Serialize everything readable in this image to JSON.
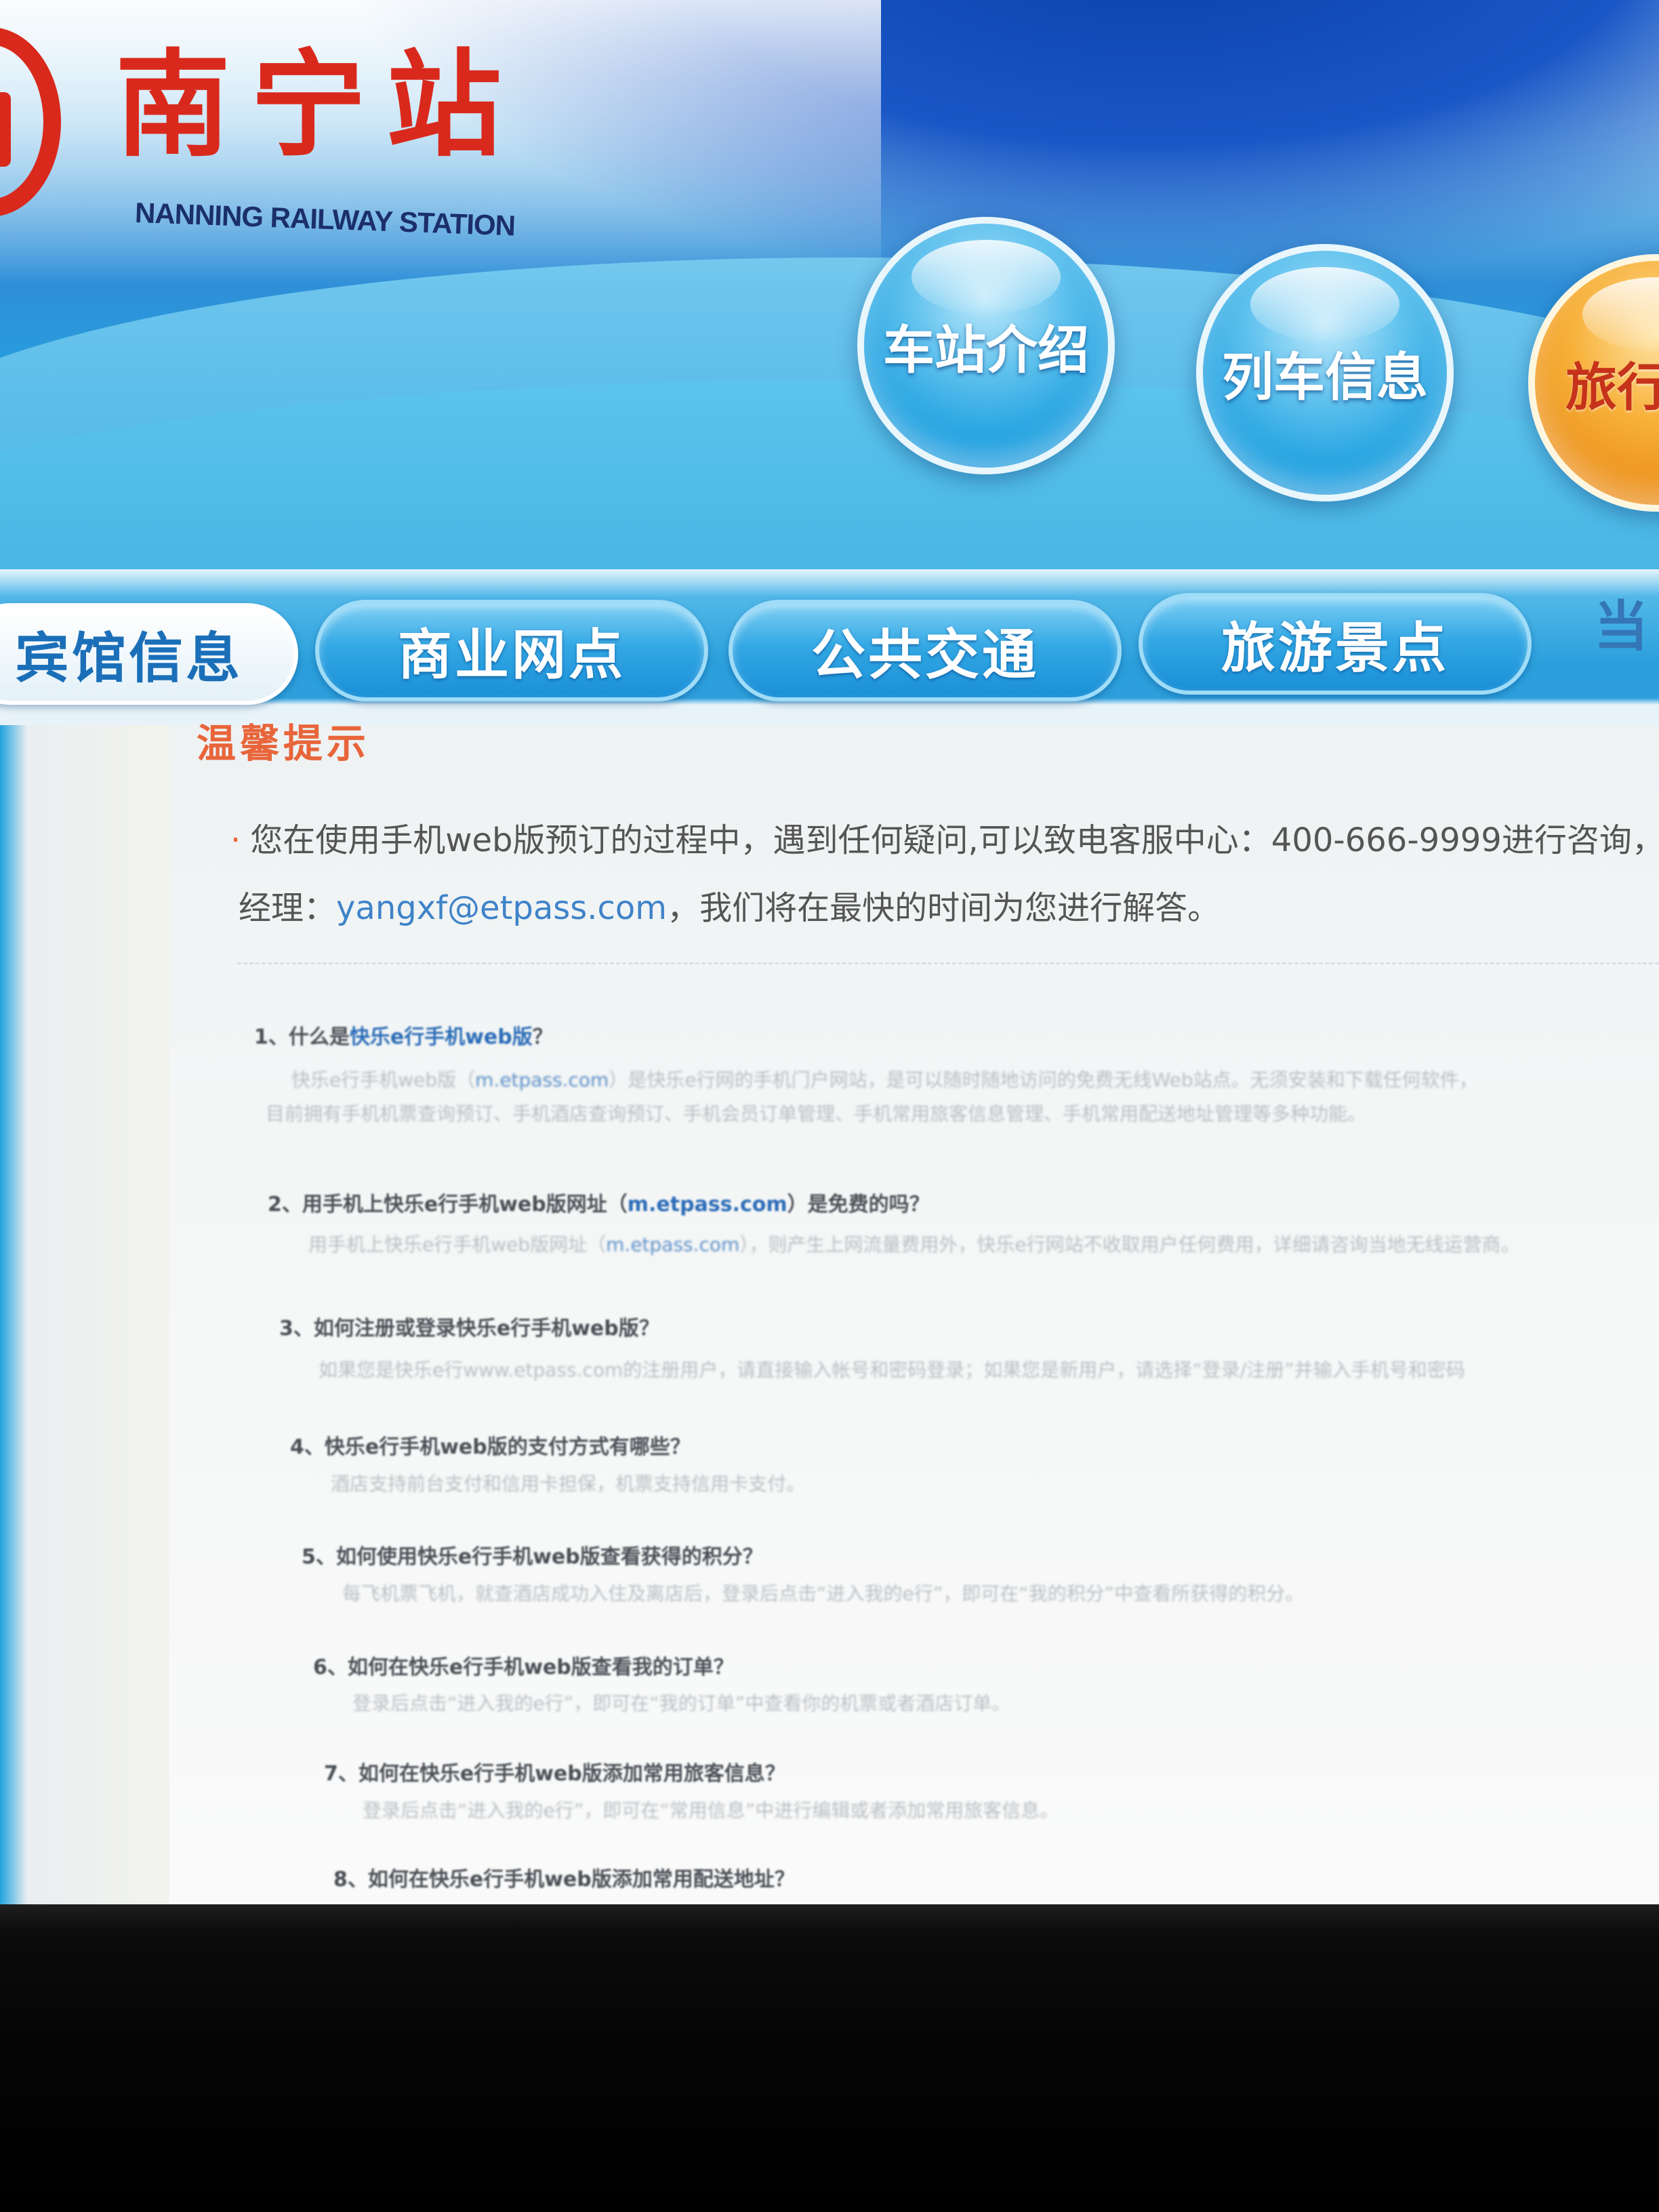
{
  "header": {
    "logo_title": "南宁站",
    "logo_subtitle": "NANNING RAILWAY STATION",
    "nav": [
      {
        "label": "车站介绍"
      },
      {
        "label": "列车信息"
      },
      {
        "label": "旅行"
      }
    ]
  },
  "tabs": [
    {
      "label": "宾馆信息",
      "active": true
    },
    {
      "label": "商业网点",
      "active": false
    },
    {
      "label": "公共交通",
      "active": false
    },
    {
      "label": "旅游景点",
      "active": false
    },
    {
      "label": "当",
      "active": false
    }
  ],
  "tips": {
    "title": "温馨提示",
    "bullet": "·",
    "line1": "您在使用手机web版预订的过程中，遇到任何疑问,可以致电客服中心：400-666-9999进行咨询，或",
    "line2_prefix": "经理：",
    "line2_email": "yangxf@etpass.com",
    "line2_suffix": "，我们将在最快的时间为您进行解答。"
  },
  "faq": [
    {
      "num": "1、",
      "q_prefix": "什么是",
      "q_hl": "快乐e行手机web版",
      "q_suffix": "？",
      "a_prefix": "快乐e行手机web版（",
      "a_hl": "m.etpass.com",
      "a_suffix": "）是快乐e行网的手机门户网站，是可以随时随地访问的免费无线Web站点。无须安装和下载任何软件，",
      "a_line2": "目前拥有手机机票查询预订、手机酒店查询预订、手机会员订单管理、手机常用旅客信息管理、手机常用配送地址管理等多种功能。"
    },
    {
      "num": "2、",
      "q_prefix": "用手机上快乐e行手机web版网址（",
      "q_hl": "m.etpass.com",
      "q_suffix": "）是免费的吗？",
      "a_prefix": "用手机上快乐e行手机web版网址（",
      "a_hl": "m.etpass.com",
      "a_suffix": "），则产生上网流量费用外，快乐e行网站不收取用户任何费用，详细请咨询当地无线运营商。"
    },
    {
      "num": "3、",
      "q_prefix": "如何注册或登录快乐e行手机web版？",
      "q_hl": "",
      "q_suffix": "",
      "a_prefix": "如果您是快乐e行www.etpass.com的注册用户，请直接输入帐号和密码登录；如果您是新用户，请选择“登录/注册”并输入手机号和密码",
      "a_hl": "",
      "a_suffix": ""
    },
    {
      "num": "4、",
      "q_prefix": "快乐e行手机web版的支付方式有哪些？",
      "q_hl": "",
      "q_suffix": "",
      "a_prefix": "酒店支持前台支付和信用卡担保，机票支持信用卡支付。",
      "a_hl": "",
      "a_suffix": ""
    },
    {
      "num": "5、",
      "q_prefix": "如何使用快乐e行手机web版查看获得的积分？",
      "q_hl": "",
      "q_suffix": "",
      "a_prefix": "每飞机票飞机，就查酒店成功入住及离店后，登录后点击“进入我的e行”，即可在“我的积分”中查看所获得的积分。",
      "a_hl": "",
      "a_suffix": ""
    },
    {
      "num": "6、",
      "q_prefix": "如何在快乐e行手机web版查看我的订单？",
      "q_hl": "",
      "q_suffix": "",
      "a_prefix": "登录后点击“进入我的e行”，即可在“我的订单”中查看你的机票或者酒店订单。",
      "a_hl": "",
      "a_suffix": ""
    },
    {
      "num": "7、",
      "q_prefix": "如何在快乐e行手机web版添加常用旅客信息？",
      "q_hl": "",
      "q_suffix": "",
      "a_prefix": "登录后点击“进入我的e行”，即可在“常用信息”中进行编辑或者添加常用旅客信息。",
      "a_hl": "",
      "a_suffix": ""
    },
    {
      "num": "8、",
      "q_prefix": "如何在快乐e行手机web版添加常用配送地址？",
      "q_hl": "",
      "q_suffix": "",
      "a_prefix": "",
      "a_hl": "",
      "a_suffix": ""
    }
  ]
}
